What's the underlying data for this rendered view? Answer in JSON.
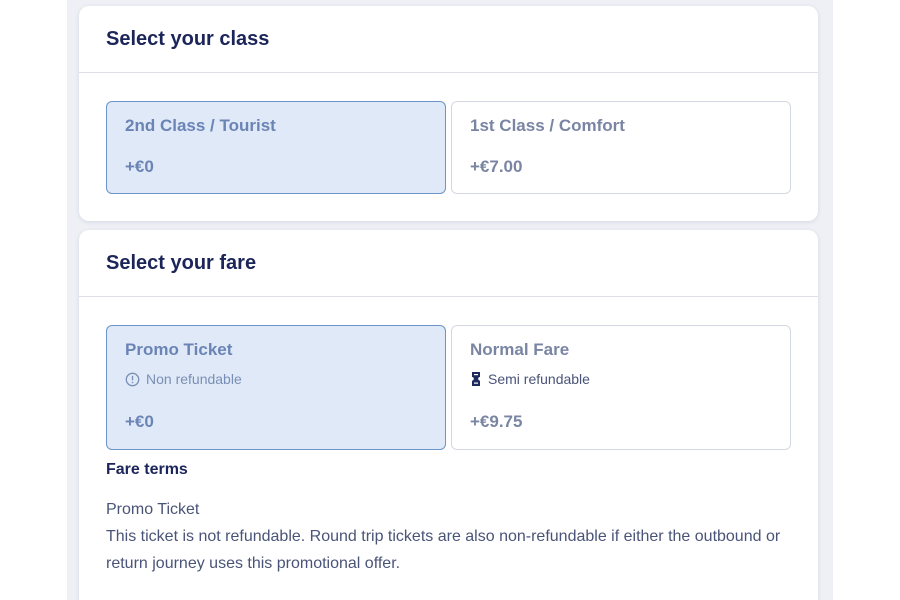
{
  "class_section": {
    "title": "Select your class",
    "options": [
      {
        "name": "2nd Class / Tourist",
        "price": "+€0",
        "selected": true
      },
      {
        "name": "1st Class / Comfort",
        "price": "+€7.00",
        "selected": false
      }
    ]
  },
  "fare_section": {
    "title": "Select your fare",
    "options": [
      {
        "name": "Promo Ticket",
        "note": "Non refundable",
        "note_icon": "info-circle-icon",
        "price": "+€0",
        "selected": true
      },
      {
        "name": "Normal Fare",
        "note": "Semi refundable",
        "note_icon": "ticket-icon",
        "price": "+€9.75",
        "selected": false
      }
    ],
    "terms": {
      "title": "Fare terms",
      "fare_name": "Promo Ticket",
      "text": "This ticket is not refundable. Round trip tickets are also non-refundable if either the outbound or return journey uses this promotional offer."
    }
  },
  "colors": {
    "selected_background": "#dfe9f7",
    "selected_border": "#6e93c8",
    "heading": "#1b2559",
    "page_background": "#eef0f6"
  }
}
